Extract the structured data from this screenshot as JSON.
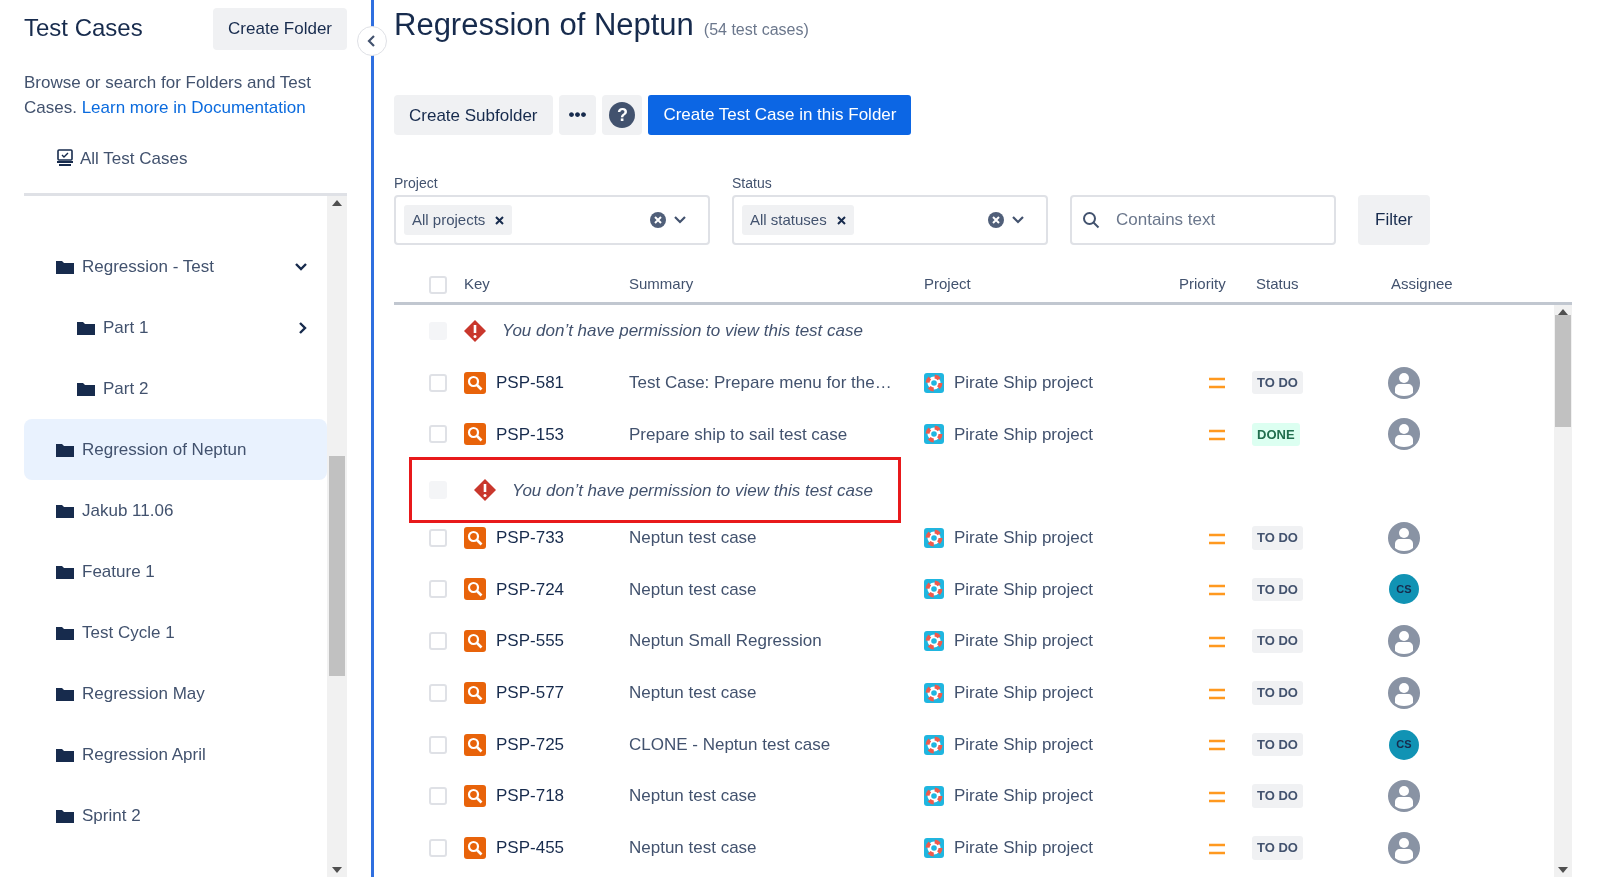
{
  "sidebar": {
    "title": "Test Cases",
    "create_button": "Create Folder",
    "description": "Browse or search for Folders and Test Cases.",
    "doc_link": "Learn more in Documentation",
    "all_item": "All Test Cases",
    "tree": [
      {
        "label": "Regression - Test",
        "expanded": true,
        "selected": false,
        "children": [
          {
            "label": "Part 1",
            "expanded": false,
            "selected": false
          },
          {
            "label": "Part 2",
            "selected": false
          }
        ]
      },
      {
        "label": "Regression of Neptun",
        "selected": true
      },
      {
        "label": "Jakub 11.06",
        "selected": false
      },
      {
        "label": "Feature 1",
        "selected": false
      },
      {
        "label": "Test Cycle 1",
        "selected": false
      },
      {
        "label": "Regression May",
        "selected": false
      },
      {
        "label": "Regression April",
        "selected": false
      },
      {
        "label": "Sprint 2",
        "selected": false
      }
    ]
  },
  "header": {
    "title": "Regression of Neptun",
    "count": "(54 test cases)"
  },
  "toolbar": {
    "subfolder": "Create Subfolder",
    "more": "•••",
    "help": "?",
    "create": "Create Test Case in this Folder"
  },
  "filters": {
    "project_label": "Project",
    "project_tag": "All projects",
    "status_label": "Status",
    "status_tag": "All statuses",
    "search_placeholder": "Contains text",
    "filter_button": "Filter"
  },
  "table": {
    "select_all_checked": false,
    "columns": [
      "Key",
      "Summary",
      "Project",
      "Priority",
      "Status",
      "Assignee"
    ],
    "rows": [
      {
        "kind": "denied",
        "disabled": true,
        "message": "You don’t have permission to view this test case",
        "highlighted": false
      },
      {
        "kind": "case",
        "checked": false,
        "key": "PSP-581",
        "summary": "Test Case: Prepare menu for the…",
        "project": "Pirate Ship project",
        "status": "TO DO",
        "done": false,
        "assignee": {
          "kind": "none"
        }
      },
      {
        "kind": "case",
        "checked": false,
        "key": "PSP-153",
        "summary": "Prepare ship to sail test case",
        "project": "Pirate Ship project",
        "status": "DONE",
        "done": true,
        "assignee": {
          "kind": "none"
        }
      },
      {
        "kind": "denied",
        "disabled": true,
        "message": "You don’t have permission to view this test case",
        "highlighted": true
      },
      {
        "kind": "case",
        "checked": false,
        "key": "PSP-733",
        "summary": "Neptun test case",
        "project": "Pirate Ship project",
        "status": "TO DO",
        "done": false,
        "assignee": {
          "kind": "none"
        }
      },
      {
        "kind": "case",
        "checked": false,
        "key": "PSP-724",
        "summary": "Neptun test case",
        "project": "Pirate Ship project",
        "status": "TO DO",
        "done": false,
        "assignee": {
          "kind": "initials",
          "initials": "CS"
        }
      },
      {
        "kind": "case",
        "checked": false,
        "key": "PSP-555",
        "summary": "Neptun Small Regression",
        "project": "Pirate Ship project",
        "status": "TO DO",
        "done": false,
        "assignee": {
          "kind": "none"
        }
      },
      {
        "kind": "case",
        "checked": false,
        "key": "PSP-577",
        "summary": "Neptun test case",
        "project": "Pirate Ship project",
        "status": "TO DO",
        "done": false,
        "assignee": {
          "kind": "none"
        }
      },
      {
        "kind": "case",
        "checked": false,
        "key": "PSP-725",
        "summary": "CLONE - Neptun test case",
        "project": "Pirate Ship project",
        "status": "TO DO",
        "done": false,
        "assignee": {
          "kind": "initials",
          "initials": "CS"
        }
      },
      {
        "kind": "case",
        "checked": false,
        "key": "PSP-718",
        "summary": "Neptun test case",
        "project": "Pirate Ship project",
        "status": "TO DO",
        "done": false,
        "assignee": {
          "kind": "none"
        }
      },
      {
        "kind": "case",
        "checked": false,
        "key": "PSP-455",
        "summary": "Neptun test case",
        "project": "Pirate Ship project",
        "status": "TO DO",
        "done": false,
        "assignee": {
          "kind": "none"
        }
      }
    ]
  }
}
